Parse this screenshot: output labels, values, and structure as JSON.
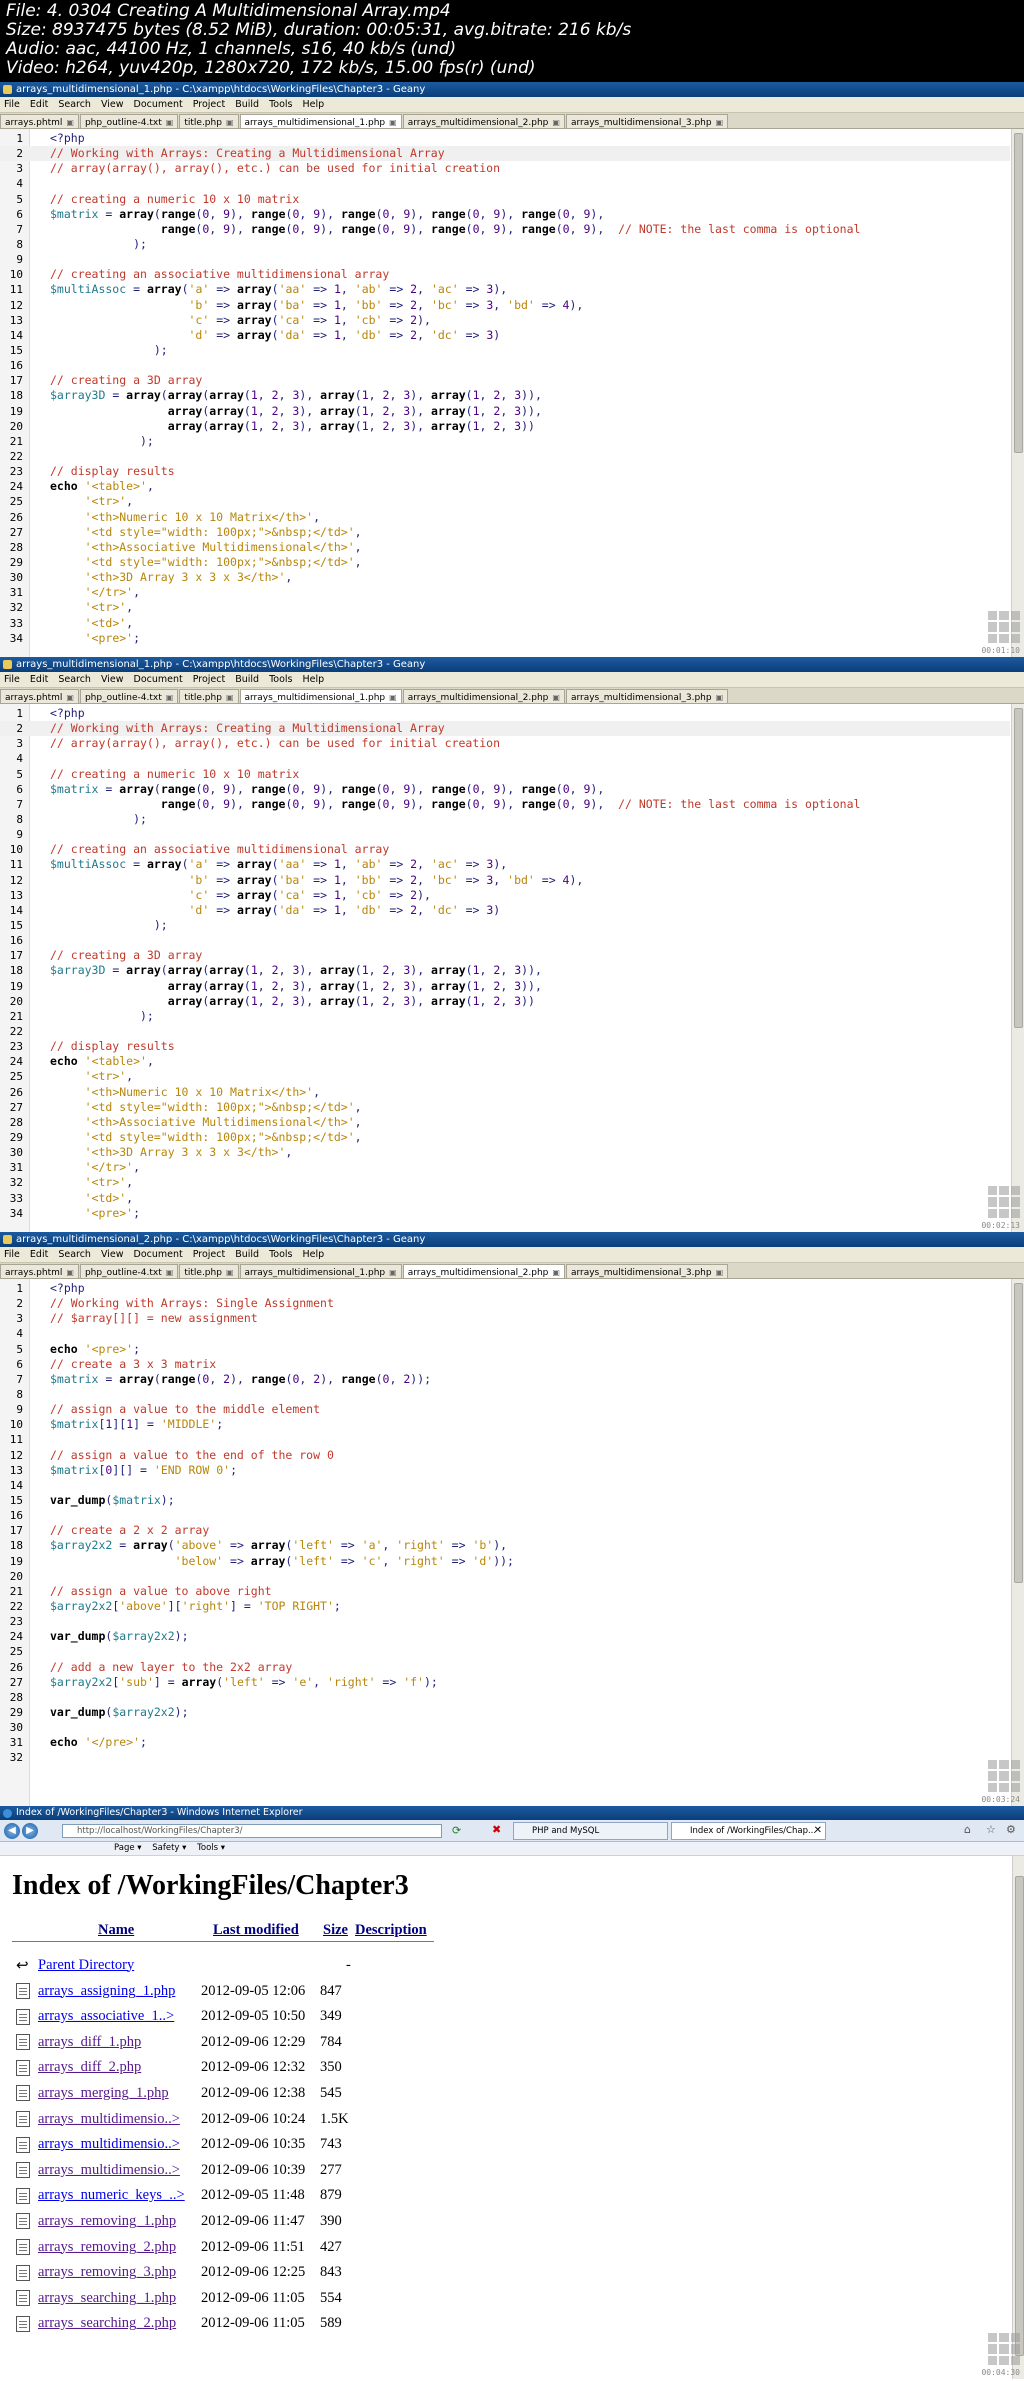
{
  "meta": {
    "lines": [
      "File: 4. 0304 Creating A Multidimensional Array.mp4",
      "Size: 8937475 bytes (8.52 MiB), duration: 00:05:31, avg.bitrate: 216 kb/s",
      "Audio: aac, 44100 Hz, 1 channels, s16, 40 kb/s (und)",
      "Video: h264, yuv420p, 1280x720, 172 kb/s, 15.00 fps(r) (und)"
    ]
  },
  "menu": [
    "File",
    "Edit",
    "Search",
    "View",
    "Document",
    "Project",
    "Build",
    "Tools",
    "Help"
  ],
  "frames": [
    {
      "title": "arrays_multidimensional_1.php - C:\\xampp\\htdocs\\WorkingFiles\\Chapter3 - Geany",
      "tabs": [
        "arrays.phtml",
        "php_outline-4.txt",
        "title.php",
        "arrays_multidimensional_1.php",
        "arrays_multidimensional_2.php",
        "arrays_multidimensional_3.php"
      ],
      "active_tab": 3,
      "timestamp": "00:01:10",
      "code": [
        {
          "n": "1",
          "t": "<?php"
        },
        {
          "n": "2",
          "t": "// Working with Arrays: Creating a Multidimensional Array"
        },
        {
          "n": "3",
          "t": "// array(array(), array(), etc.) can be used for initial creation"
        },
        {
          "n": "4",
          "t": ""
        },
        {
          "n": "5",
          "t": "// creating a numeric 10 x 10 matrix"
        },
        {
          "n": "6",
          "t": "$matrix = array(range(0, 9), range(0, 9), range(0, 9), range(0, 9), range(0, 9),"
        },
        {
          "n": "7",
          "t": "                range(0, 9), range(0, 9), range(0, 9), range(0, 9), range(0, 9),  // NOTE: the last comma is optional"
        },
        {
          "n": "8",
          "t": "            );"
        },
        {
          "n": "9",
          "t": ""
        },
        {
          "n": "10",
          "t": "// creating an associative multidimensional array"
        },
        {
          "n": "11",
          "t": "$multiAssoc = array('a' => array('aa' => 1, 'ab' => 2, 'ac' => 3),"
        },
        {
          "n": "12",
          "t": "                    'b' => array('ba' => 1, 'bb' => 2, 'bc' => 3, 'bd' => 4),"
        },
        {
          "n": "13",
          "t": "                    'c' => array('ca' => 1, 'cb' => 2),"
        },
        {
          "n": "14",
          "t": "                    'd' => array('da' => 1, 'db' => 2, 'dc' => 3)"
        },
        {
          "n": "15",
          "t": "               );"
        },
        {
          "n": "16",
          "t": ""
        },
        {
          "n": "17",
          "t": "// creating a 3D array"
        },
        {
          "n": "18",
          "t": "$array3D = array(array(array(1, 2, 3), array(1, 2, 3), array(1, 2, 3)),"
        },
        {
          "n": "19",
          "t": "                 array(array(1, 2, 3), array(1, 2, 3), array(1, 2, 3)),"
        },
        {
          "n": "20",
          "t": "                 array(array(1, 2, 3), array(1, 2, 3), array(1, 2, 3))"
        },
        {
          "n": "21",
          "t": "             );"
        },
        {
          "n": "22",
          "t": ""
        },
        {
          "n": "23",
          "t": "// display results"
        },
        {
          "n": "24",
          "t": "echo '<table>',"
        },
        {
          "n": "25",
          "t": "     '<tr>',"
        },
        {
          "n": "26",
          "t": "     '<th>Numeric 10 x 10 Matrix</th>',"
        },
        {
          "n": "27",
          "t": "     '<td style=\"width: 100px;\">&nbsp;</td>',"
        },
        {
          "n": "28",
          "t": "     '<th>Associative Multidimensional</th>',"
        },
        {
          "n": "29",
          "t": "     '<td style=\"width: 100px;\">&nbsp;</td>',"
        },
        {
          "n": "30",
          "t": "     '<th>3D Array 3 x 3 x 3</th>',"
        },
        {
          "n": "31",
          "t": "     '</tr>',"
        },
        {
          "n": "32",
          "t": "     '<tr>',"
        },
        {
          "n": "33",
          "t": "     '<td>',"
        },
        {
          "n": "34",
          "t": "     '<pre>';"
        }
      ]
    },
    {
      "title": "arrays_multidimensional_1.php - C:\\xampp\\htdocs\\WorkingFiles\\Chapter3 - Geany",
      "tabs": [
        "arrays.phtml",
        "php_outline-4.txt",
        "title.php",
        "arrays_multidimensional_1.php",
        "arrays_multidimensional_2.php",
        "arrays_multidimensional_3.php"
      ],
      "active_tab": 3,
      "timestamp": "00:02:13",
      "code": [
        {
          "n": "1",
          "t": "<?php"
        },
        {
          "n": "2",
          "t": "// Working with Arrays: Creating a Multidimensional Array"
        },
        {
          "n": "3",
          "t": "// array(array(), array(), etc.) can be used for initial creation"
        },
        {
          "n": "4",
          "t": ""
        },
        {
          "n": "5",
          "t": "// creating a numeric 10 x 10 matrix"
        },
        {
          "n": "6",
          "t": "$matrix = array(range(0, 9), range(0, 9), range(0, 9), range(0, 9), range(0, 9),"
        },
        {
          "n": "7",
          "t": "                range(0, 9), range(0, 9), range(0, 9), range(0, 9), range(0, 9),  // NOTE: the last comma is optional"
        },
        {
          "n": "8",
          "t": "            );"
        },
        {
          "n": "9",
          "t": ""
        },
        {
          "n": "10",
          "t": "// creating an associative multidimensional array"
        },
        {
          "n": "11",
          "t": "$multiAssoc = array('a' => array('aa' => 1, 'ab' => 2, 'ac' => 3),"
        },
        {
          "n": "12",
          "t": "                    'b' => array('ba' => 1, 'bb' => 2, 'bc' => 3, 'bd' => 4),"
        },
        {
          "n": "13",
          "t": "                    'c' => array('ca' => 1, 'cb' => 2),"
        },
        {
          "n": "14",
          "t": "                    'd' => array('da' => 1, 'db' => 2, 'dc' => 3)"
        },
        {
          "n": "15",
          "t": "               );"
        },
        {
          "n": "16",
          "t": ""
        },
        {
          "n": "17",
          "t": "// creating a 3D array"
        },
        {
          "n": "18",
          "t": "$array3D = array(array(array(1, 2, 3), array(1, 2, 3), array(1, 2, 3)),"
        },
        {
          "n": "19",
          "t": "                 array(array(1, 2, 3), array(1, 2, 3), array(1, 2, 3)),"
        },
        {
          "n": "20",
          "t": "                 array(array(1, 2, 3), array(1, 2, 3), array(1, 2, 3))"
        },
        {
          "n": "21",
          "t": "             );"
        },
        {
          "n": "22",
          "t": ""
        },
        {
          "n": "23",
          "t": "// display results"
        },
        {
          "n": "24",
          "t": "echo '<table>',"
        },
        {
          "n": "25",
          "t": "     '<tr>',"
        },
        {
          "n": "26",
          "t": "     '<th>Numeric 10 x 10 Matrix</th>',"
        },
        {
          "n": "27",
          "t": "     '<td style=\"width: 100px;\">&nbsp;</td>',"
        },
        {
          "n": "28",
          "t": "     '<th>Associative Multidimensional</th>',"
        },
        {
          "n": "29",
          "t": "     '<td style=\"width: 100px;\">&nbsp;</td>',"
        },
        {
          "n": "30",
          "t": "     '<th>3D Array 3 x 3 x 3</th>',"
        },
        {
          "n": "31",
          "t": "     '</tr>',"
        },
        {
          "n": "32",
          "t": "     '<tr>',"
        },
        {
          "n": "33",
          "t": "     '<td>',"
        },
        {
          "n": "34",
          "t": "     '<pre>';"
        }
      ]
    },
    {
      "title": "arrays_multidimensional_2.php - C:\\xampp\\htdocs\\WorkingFiles\\Chapter3 - Geany",
      "tabs": [
        "arrays.phtml",
        "php_outline-4.txt",
        "title.php",
        "arrays_multidimensional_1.php",
        "arrays_multidimensional_2.php",
        "arrays_multidimensional_3.php"
      ],
      "active_tab": 4,
      "timestamp": "00:03:24",
      "code": [
        {
          "n": "1",
          "t": "<?php"
        },
        {
          "n": "2",
          "t": "// Working with Arrays: Single Assignment"
        },
        {
          "n": "3",
          "t": "// $array[][] = new assignment"
        },
        {
          "n": "4",
          "t": ""
        },
        {
          "n": "5",
          "t": "echo '<pre>';"
        },
        {
          "n": "6",
          "t": "// create a 3 x 3 matrix"
        },
        {
          "n": "7",
          "t": "$matrix = array(range(0, 2), range(0, 2), range(0, 2));"
        },
        {
          "n": "8",
          "t": ""
        },
        {
          "n": "9",
          "t": "// assign a value to the middle element"
        },
        {
          "n": "10",
          "t": "$matrix[1][1] = 'MIDDLE';"
        },
        {
          "n": "11",
          "t": ""
        },
        {
          "n": "12",
          "t": "// assign a value to the end of the row 0"
        },
        {
          "n": "13",
          "t": "$matrix[0][] = 'END ROW 0';"
        },
        {
          "n": "14",
          "t": ""
        },
        {
          "n": "15",
          "t": "var_dump($matrix);"
        },
        {
          "n": "16",
          "t": ""
        },
        {
          "n": "17",
          "t": "// create a 2 x 2 array"
        },
        {
          "n": "18",
          "t": "$array2x2 = array('above' => array('left' => 'a', 'right' => 'b'),"
        },
        {
          "n": "19",
          "t": "                  'below' => array('left' => 'c', 'right' => 'd'));"
        },
        {
          "n": "20",
          "t": ""
        },
        {
          "n": "21",
          "t": "// assign a value to above right"
        },
        {
          "n": "22",
          "t": "$array2x2['above']['right'] = 'TOP RIGHT';"
        },
        {
          "n": "23",
          "t": ""
        },
        {
          "n": "24",
          "t": "var_dump($array2x2);"
        },
        {
          "n": "25",
          "t": ""
        },
        {
          "n": "26",
          "t": "// add a new layer to the 2x2 array"
        },
        {
          "n": "27",
          "t": "$array2x2['sub'] = array('left' => 'e', 'right' => 'f');"
        },
        {
          "n": "28",
          "t": ""
        },
        {
          "n": "29",
          "t": "var_dump($array2x2);"
        },
        {
          "n": "30",
          "t": ""
        },
        {
          "n": "31",
          "t": "echo '</pre>';"
        },
        {
          "n": "32",
          "t": ""
        }
      ]
    }
  ],
  "browser": {
    "title": "Index of /WorkingFiles/Chapter3 - Windows Internet Explorer",
    "address": "http://localhost/WorkingFiles/Chapter3/",
    "tabs": [
      "PHP and MySQL",
      "Index of /WorkingFiles/Chap..."
    ],
    "commands": [
      "Page ▾",
      "Safety ▾",
      "Tools ▾"
    ],
    "timestamp": "00:04:30",
    "heading": "Index of /WorkingFiles/Chapter3",
    "columns": {
      "name": "Name",
      "modified": "Last modified",
      "size": "Size",
      "description": "Description"
    },
    "parent": {
      "name": "Parent Directory",
      "size": "-"
    },
    "files": [
      {
        "name": "arrays_assigning_1.php",
        "date": "2012-09-05 12:06",
        "size": "847",
        "visited": false
      },
      {
        "name": "arrays_associative_1..>",
        "date": "2012-09-05 10:50",
        "size": "349",
        "visited": false
      },
      {
        "name": "arrays_diff_1.php",
        "date": "2012-09-06 12:29",
        "size": "784",
        "visited": true
      },
      {
        "name": "arrays_diff_2.php",
        "date": "2012-09-06 12:32",
        "size": "350",
        "visited": true
      },
      {
        "name": "arrays_merging_1.php",
        "date": "2012-09-06 12:38",
        "size": "545",
        "visited": true
      },
      {
        "name": "arrays_multidimensio..>",
        "date": "2012-09-06 10:24",
        "size": "1.5K",
        "visited": true
      },
      {
        "name": "arrays_multidimensio..>",
        "date": "2012-09-06 10:35",
        "size": "743",
        "visited": false
      },
      {
        "name": "arrays_multidimensio..>",
        "date": "2012-09-06 10:39",
        "size": "277",
        "visited": true
      },
      {
        "name": "arrays_numeric_keys_..>",
        "date": "2012-09-05 11:48",
        "size": "879",
        "visited": false
      },
      {
        "name": "arrays_removing_1.php",
        "date": "2012-09-06 11:47",
        "size": "390",
        "visited": true
      },
      {
        "name": "arrays_removing_2.php",
        "date": "2012-09-06 11:51",
        "size": "427",
        "visited": true
      },
      {
        "name": "arrays_removing_3.php",
        "date": "2012-09-06 12:25",
        "size": "843",
        "visited": true
      },
      {
        "name": "arrays_searching_1.php",
        "date": "2012-09-06 11:05",
        "size": "554",
        "visited": true
      },
      {
        "name": "arrays_searching_2.php",
        "date": "2012-09-06 11:05",
        "size": "589",
        "visited": true
      }
    ]
  },
  "colors": {
    "comment": "#c0392b",
    "variable": "#1f7a8c",
    "keyword": "#000000",
    "string": "#b8860b",
    "number": "#4b0082"
  }
}
